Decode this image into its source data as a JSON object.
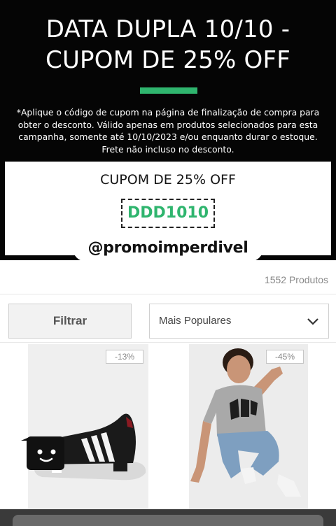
{
  "banner": {
    "title_line1": "DATA DUPLA 10/10 -",
    "title_line2": "CUPOM DE 25% OFF",
    "notice": "*Aplique o código de cupom na página de finalização de compra para obter o desconto. Válido apenas em produtos selecionados para esta campanha, somente até 10/10/2023 e/ou enquanto durar o estoque. Frete não incluso no desconto.",
    "accent_color": "#2fb56e"
  },
  "coupon": {
    "heading": "CUPOM DE 25% OFF",
    "code": "DDD1010"
  },
  "watermark": {
    "handle": "@promoimperdivel"
  },
  "listing": {
    "product_count": "1552 Produtos",
    "filter_label": "Filtrar",
    "sort_selected": "Mais Populares"
  },
  "products": [
    {
      "discount": "-13%",
      "image": "black sneaker with white stripes"
    },
    {
      "discount": "-45%",
      "image": "man in grey GAP t-shirt and jeans"
    }
  ],
  "icons": {
    "sort": "chevron-down-icon",
    "chat": "chat-bot-icon"
  }
}
